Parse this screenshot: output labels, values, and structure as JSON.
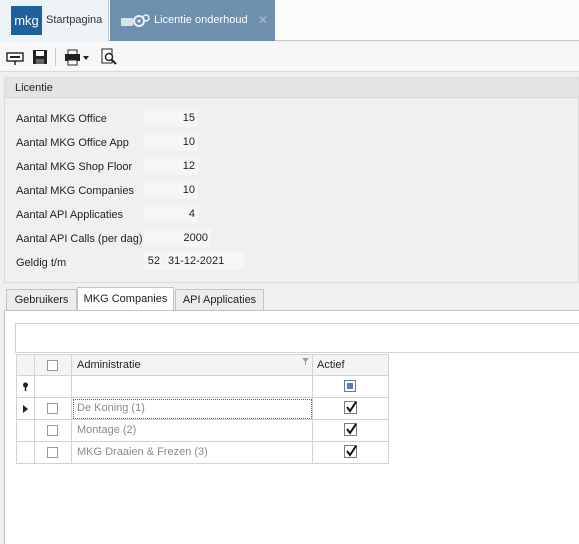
{
  "tabs": [
    {
      "logo_text": "mkg",
      "label": "Startpagina"
    },
    {
      "label": "Licentie onderhoud",
      "close_glyph": "✕"
    }
  ],
  "panel": {
    "title": "Licentie",
    "fields": [
      {
        "label": "Aantal MKG Office",
        "value": "15"
      },
      {
        "label": "Aantal MKG Office App",
        "value": "10"
      },
      {
        "label": "Aantal MKG Shop Floor",
        "value": "12"
      },
      {
        "label": "Aantal MKG Companies",
        "value": "10"
      },
      {
        "label": "Aantal API Applicaties",
        "value": "4"
      },
      {
        "label": "Aantal API Calls (per dag)",
        "value": "2000"
      }
    ],
    "geldig": {
      "label": "Geldig t/m",
      "week": "52",
      "date": "31-12-2021"
    }
  },
  "subtabs": [
    "Gebruikers",
    "MKG Companies",
    "API Applicaties"
  ],
  "grid": {
    "headers": {
      "administratie": "Administratie",
      "actief": "Actief"
    },
    "rows": [
      {
        "administratie": "De Koning (1)",
        "actief": true
      },
      {
        "administratie": "Montage (2)",
        "actief": true
      },
      {
        "administratie": "MKG Draaien & Frezen (3)",
        "actief": true
      }
    ]
  }
}
